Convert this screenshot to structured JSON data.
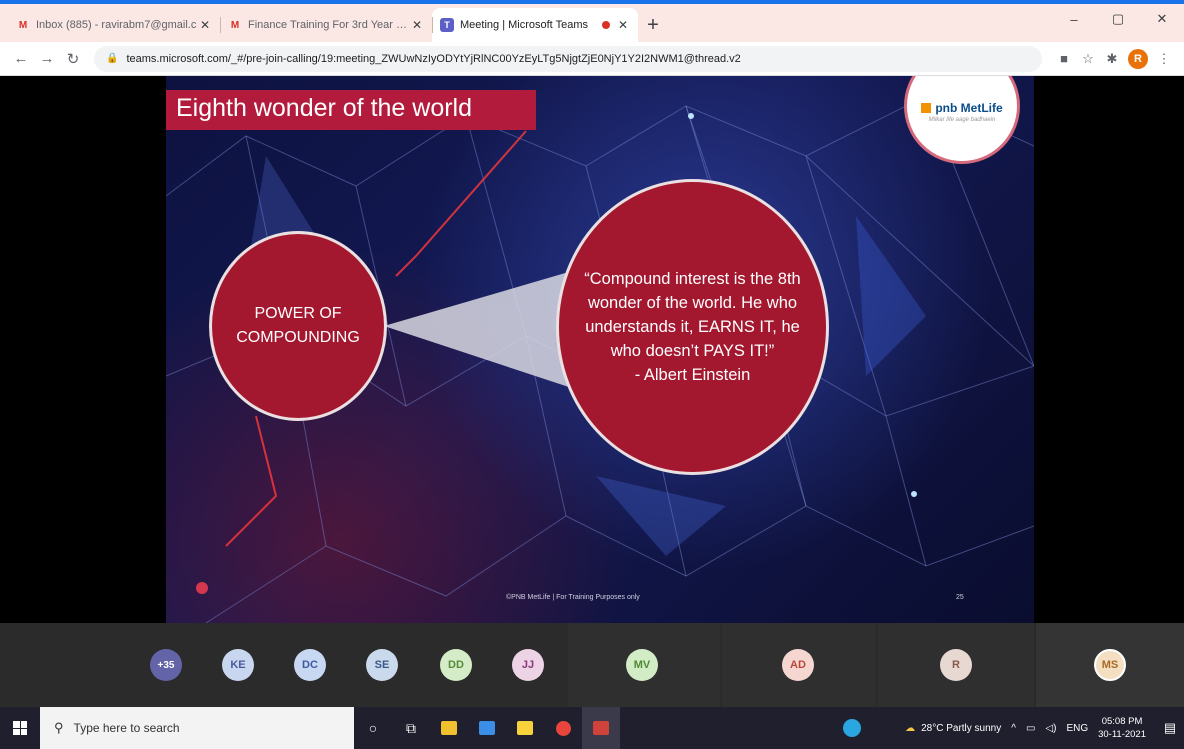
{
  "browser": {
    "tabs": [
      {
        "icon": "gmail-icon",
        "title": "Inbox (885) - ravirabm7@gmail.c",
        "active": false
      },
      {
        "icon": "gmail-icon",
        "title": "Finance Training For 3rd Year Co",
        "active": false
      },
      {
        "icon": "teams-icon",
        "title": "Meeting | Microsoft Teams",
        "active": true
      }
    ],
    "new_tab": "+",
    "close": "✕",
    "window_controls": {
      "minimize": "–",
      "maximize": "▢",
      "close": "✕"
    },
    "address": "teams.microsoft.com/_#/pre-join-calling/19:meeting_ZWUwNzIyODYtYjRlNC00YzEyLTg5NjgtZjE0NjY1Y2I2NWM1@thread.v2",
    "profile_initial": "R"
  },
  "slide": {
    "title": "Eighth wonder of the world",
    "logo_brand": "pnb MetLife",
    "logo_tagline": "Milkar life aage badhaein",
    "left_circle_text": "POWER OF COMPOUNDING",
    "quote": "“Compound interest is the 8th wonder of the world. He who understands it, EARNS IT,  he who doesn’t PAYS IT!”\n- Albert Einstein",
    "footer": "©PNB MetLife | For Training Purposes only",
    "page_number": "25"
  },
  "participants": {
    "overflow": "+35",
    "list": [
      {
        "initials": "KE",
        "bg": "#c8d6f0",
        "fg": "#4a5a9a"
      },
      {
        "initials": "DC",
        "bg": "#c9d8f2",
        "fg": "#3c5aa0"
      },
      {
        "initials": "SE",
        "bg": "#cad9ec",
        "fg": "#3a5a8a"
      },
      {
        "initials": "DD",
        "bg": "#d4ecc8",
        "fg": "#5a8a3a"
      },
      {
        "initials": "JJ",
        "bg": "#ecd4e6",
        "fg": "#8a3a7a"
      },
      {
        "initials": "MV",
        "bg": "#d2ecc6",
        "fg": "#4f8a34"
      },
      {
        "initials": "AD",
        "bg": "#f6d6d0",
        "fg": "#b84a3a"
      },
      {
        "initials": "R",
        "bg": "#e8d8d2",
        "fg": "#8a5a4a"
      },
      {
        "initials": "MS",
        "bg": "#f4dfc2",
        "fg": "#a86a24"
      }
    ]
  },
  "taskbar": {
    "search_placeholder": "Type here to search",
    "weather": "28°C  Partly sunny",
    "language": "ENG",
    "time": "05:08 PM",
    "date": "30-11-2021"
  },
  "colors": {
    "slide_red": "#a3172f",
    "title_red": "#b31b3c",
    "teams_purple": "#6264a7"
  }
}
